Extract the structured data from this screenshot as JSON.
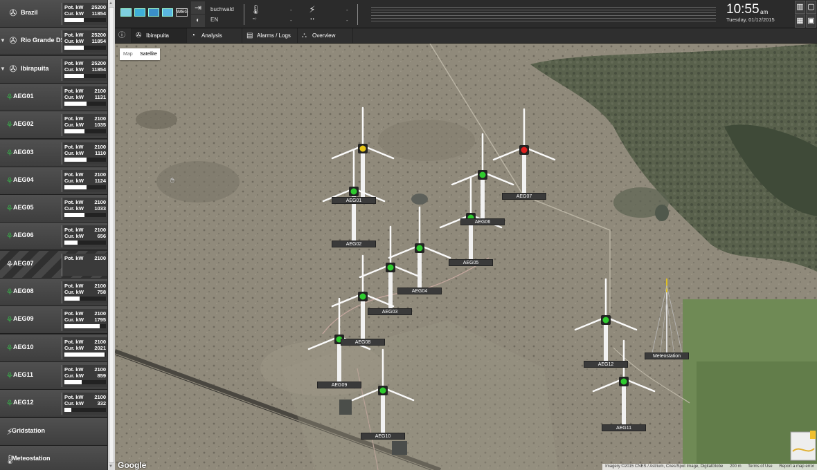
{
  "sidebar": {
    "groups": [
      {
        "label": "Brazil",
        "pot_label": "Pot. kW",
        "pot": "25200",
        "cur_label": "Cur. kW",
        "cur": "11854",
        "fill": 0.47
      },
      {
        "label": "Rio Grande DS",
        "pot_label": "Pot. kW",
        "pot": "25200",
        "cur_label": "Cur. kW",
        "cur": "11854",
        "fill": 0.47
      },
      {
        "label": "Ibirapuita",
        "pot_label": "Pot. kW",
        "pot": "25200",
        "cur_label": "Cur. kW",
        "cur": "11854",
        "fill": 0.47
      }
    ],
    "turbines": [
      {
        "label": "AEG01",
        "pot_label": "Pot. kW",
        "pot": "2100",
        "cur_label": "Cur. kW",
        "cur": "1131",
        "fill": 0.54,
        "alarm": false
      },
      {
        "label": "AEG02",
        "pot_label": "Pot. kW",
        "pot": "2100",
        "cur_label": "Cur. kW",
        "cur": "1035",
        "fill": 0.49,
        "alarm": false
      },
      {
        "label": "AEG03",
        "pot_label": "Pot. kW",
        "pot": "2100",
        "cur_label": "Cur. kW",
        "cur": "1110",
        "fill": 0.53,
        "alarm": false
      },
      {
        "label": "AEG04",
        "pot_label": "Pot. kW",
        "pot": "2100",
        "cur_label": "Cur. kW",
        "cur": "1124",
        "fill": 0.54,
        "alarm": false
      },
      {
        "label": "AEG05",
        "pot_label": "Pot. kW",
        "pot": "2100",
        "cur_label": "Cur. kW",
        "cur": "1033",
        "fill": 0.49,
        "alarm": false
      },
      {
        "label": "AEG06",
        "pot_label": "Pot. kW",
        "pot": "2100",
        "cur_label": "Cur. kW",
        "cur": "656",
        "fill": 0.31,
        "alarm": false
      },
      {
        "label": "AEG07",
        "pot_label": "Pot. kW",
        "pot": "2100",
        "cur_label": "",
        "cur": "",
        "fill": 0,
        "alarm": true
      },
      {
        "label": "AEG08",
        "pot_label": "Pot. kW",
        "pot": "2100",
        "cur_label": "Cur. kW",
        "cur": "758",
        "fill": 0.36,
        "alarm": false
      },
      {
        "label": "AEG09",
        "pot_label": "Pot. kW",
        "pot": "2100",
        "cur_label": "Cur. kW",
        "cur": "1795",
        "fill": 0.85,
        "alarm": false
      },
      {
        "label": "AEG10",
        "pot_label": "Pot. kW",
        "pot": "2100",
        "cur_label": "Cur. kW",
        "cur": "2021",
        "fill": 0.96,
        "alarm": false
      },
      {
        "label": "AEG11",
        "pot_label": "Pot. kW",
        "pot": "2100",
        "cur_label": "Cur. kW",
        "cur": "859",
        "fill": 0.41,
        "alarm": false
      },
      {
        "label": "AEG12",
        "pot_label": "Pot. kW",
        "pot": "2100",
        "cur_label": "Cur. kW",
        "cur": "332",
        "fill": 0.16,
        "alarm": false
      }
    ],
    "gridstation": "Gridstation",
    "meteostation": "Meteostation"
  },
  "header": {
    "user": "buchwald",
    "language": "EN",
    "temp_value": "-",
    "temp_sub": "-",
    "power_value": "-",
    "power_sub": "-",
    "time": "10:55",
    "ampm": "am",
    "date": "Tuesday, 01/12/2015",
    "logo": "WEG"
  },
  "tabs": {
    "park": "Ibirapuita",
    "analysis": "Analysis",
    "alarms": "Alarms / Logs",
    "overview": "Overview"
  },
  "map": {
    "type_map": "Map",
    "type_satellite": "Satellite",
    "google": "Google",
    "imagery": "Imagery ©2015 CNES / Astrium, Cnes/Spot Image, DigitalGlobe",
    "scale": "200 m",
    "terms": "Terms of Use",
    "report": "Report a map error",
    "markers": [
      {
        "label": "AEG01",
        "status": "warning"
      },
      {
        "label": "AEG02",
        "status": "ok"
      },
      {
        "label": "AEG03",
        "status": "ok"
      },
      {
        "label": "AEG04",
        "status": "ok"
      },
      {
        "label": "AEG05",
        "status": "ok"
      },
      {
        "label": "AEG06",
        "status": "ok"
      },
      {
        "label": "AEG07",
        "status": "alarm"
      },
      {
        "label": "AEG08",
        "status": "ok"
      },
      {
        "label": "AEG09",
        "status": "ok"
      },
      {
        "label": "AEG10",
        "status": "ok"
      },
      {
        "label": "AEG11",
        "status": "ok"
      },
      {
        "label": "AEG12",
        "status": "ok"
      }
    ],
    "meteostation_label": "Meteostation"
  },
  "colors": {
    "ok": "#2ecc2e",
    "warning": "#e8c516",
    "alarm": "#e02020",
    "turbine_icon": "#3aa34a"
  }
}
